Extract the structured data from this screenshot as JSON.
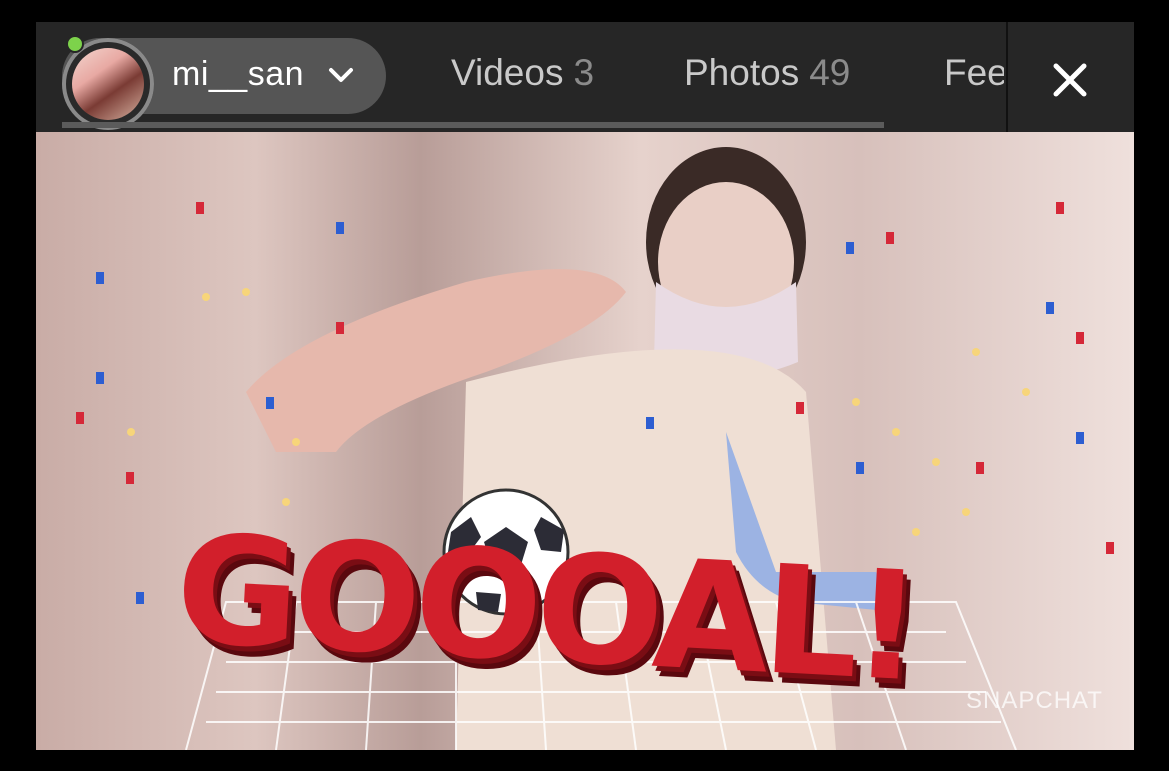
{
  "header": {
    "username": "mi__san",
    "tabs": [
      {
        "label": "Videos",
        "count": "3"
      },
      {
        "label": "Photos",
        "count": "49"
      },
      {
        "label": "Fee",
        "count": ""
      }
    ]
  },
  "video": {
    "watermark": "SNAPCHAT",
    "overlay_text": "GOOOAL!"
  },
  "colors": {
    "online": "#7dd24b",
    "goal_red": "#d21f2b",
    "bar_bg": "#262626"
  }
}
